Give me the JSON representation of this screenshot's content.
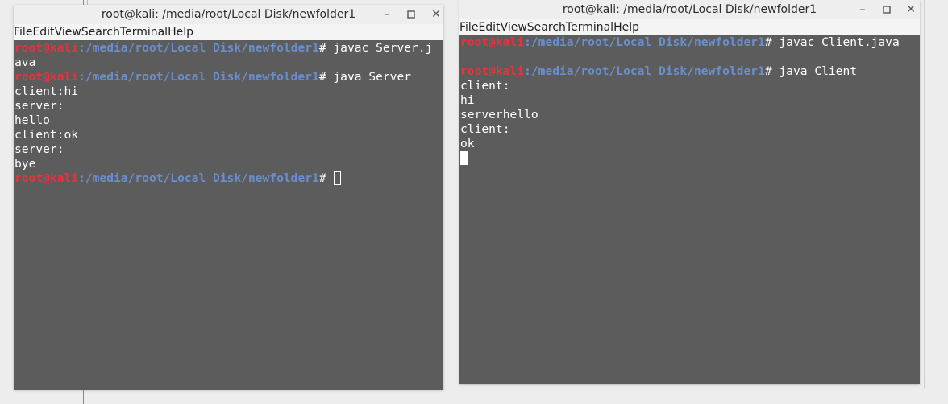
{
  "server_window": {
    "title": "root@kali: /media/root/Local Disk/newfolder1",
    "controls": {
      "minimize": "–",
      "maximize": "▫",
      "close": "✕"
    },
    "menu": [
      "File",
      "Edit",
      "View",
      "Search",
      "Terminal",
      "Help"
    ],
    "prompt_user": "root@kali",
    "prompt_path": ":/media/root/Local Disk/newfolder1",
    "prompt_hash": "# ",
    "cmd1_part1": "javac Server.j",
    "cmd1_part2": "ava",
    "cmd2": "java Server",
    "output": [
      "client:hi",
      "server:",
      "hello",
      "client:ok",
      "server:",
      "bye"
    ]
  },
  "client_window": {
    "title": "root@kali: /media/root/Local Disk/newfolder1",
    "controls": {
      "minimize": "–",
      "maximize": "▫",
      "close": "✕"
    },
    "menu": [
      "File",
      "Edit",
      "View",
      "Search",
      "Terminal",
      "Help"
    ],
    "prompt_user": "root@kali",
    "prompt_path": ":/media/root/Local Disk/newfolder1",
    "prompt_hash": "# ",
    "cmd1": "javac Client.java",
    "cmd2": "java Client",
    "output": [
      "client:",
      "hi",
      "serverhello",
      "client:",
      "ok"
    ]
  }
}
